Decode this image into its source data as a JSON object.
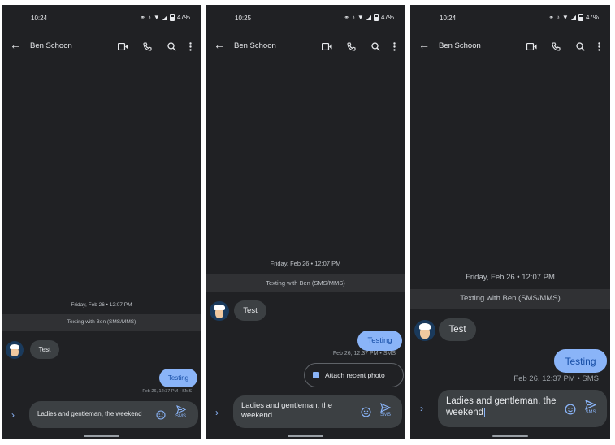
{
  "screens": [
    {
      "time": "10:24",
      "battery": "47%",
      "contact_name": "Ben Schoon",
      "date_label": "Friday, Feb 26 • 12:07 PM",
      "texting_label": "Texting with Ben (SMS/MMS)",
      "incoming_message": "Test",
      "outgoing_message": "Testing",
      "outgoing_meta": "Feb 26, 12:37 PM • SMS",
      "compose_text": "Ladies and gentleman, the weekend",
      "send_label": "SMS"
    },
    {
      "time": "10:25",
      "battery": "47%",
      "contact_name": "Ben Schoon",
      "date_label": "Friday, Feb 26 • 12:07 PM",
      "texting_label": "Texting with Ben (SMS/MMS)",
      "incoming_message": "Test",
      "outgoing_message": "Testing",
      "outgoing_meta": "Feb 26, 12:37 PM • SMS",
      "attach_label": "Attach recent photo",
      "compose_text": "Ladies and gentleman, the weekend",
      "send_label": "SMS"
    },
    {
      "time": "10:24",
      "battery": "47%",
      "contact_name": "Ben Schoon",
      "date_label": "Friday, Feb 26 • 12:07 PM",
      "texting_label": "Texting with Ben (SMS/MMS)",
      "incoming_message": "Test",
      "outgoing_message": "Testing",
      "outgoing_meta": "Feb 26, 12:37 PM • SMS",
      "compose_text": "Ladies and gentleman, the weekend",
      "send_label": "SMS"
    }
  ],
  "icons": {
    "back": "arrow-left",
    "video": "video-camera",
    "call": "phone",
    "search": "magnifier",
    "more": "vertical-dots",
    "expand": "chevron-right",
    "emoji": "smiley",
    "send": "paper-plane",
    "attach": "image"
  },
  "colors": {
    "background": "#202124",
    "outgoing_bubble": "#8ab4f8",
    "incoming_bubble": "#3c4043",
    "accent": "#8ab4f8"
  }
}
